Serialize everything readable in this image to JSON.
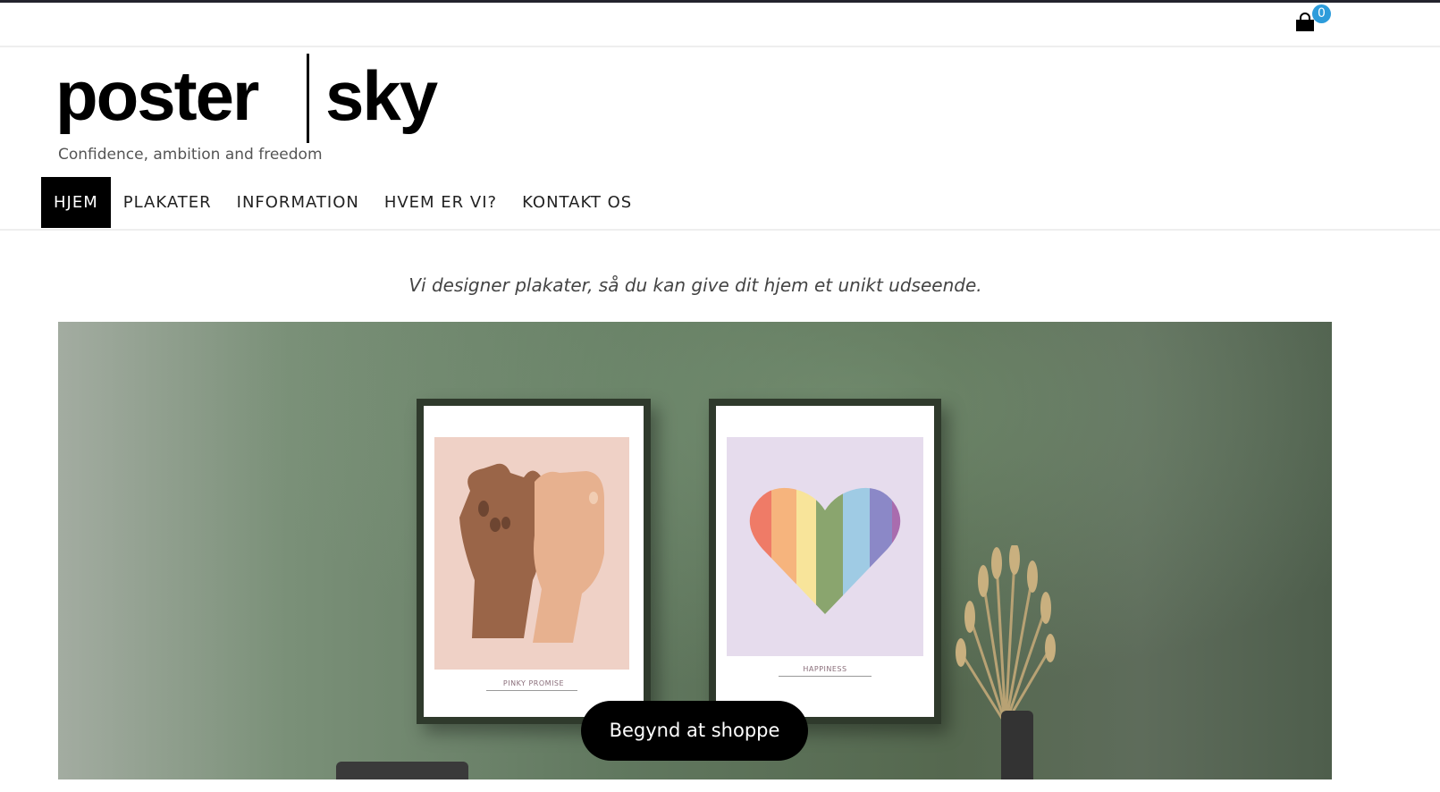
{
  "topbar": {
    "cart_icon": "shopping-bag-icon",
    "cart_count": "0"
  },
  "header": {
    "logo_left": "poster",
    "logo_right": "sky",
    "tagline": "Confidence, ambition and freedom"
  },
  "nav": {
    "items": [
      {
        "label": "HJEM",
        "active": true
      },
      {
        "label": "PLAKATER",
        "active": false
      },
      {
        "label": "INFORMATION",
        "active": false
      },
      {
        "label": "HVEM ER VI?",
        "active": false
      },
      {
        "label": "KONTAKT OS",
        "active": false
      }
    ]
  },
  "main": {
    "intro": "Vi designer plakater, så du kan give dit hjem et unikt udseende.",
    "hero": {
      "poster_1_title": "PINKY PROMISE",
      "poster_2_title": "HAPPINESS",
      "cta_label": "Begynd at shoppe"
    }
  },
  "colors": {
    "accent": "#000000",
    "badge": "#2d9cdb",
    "wall": "#60775e"
  }
}
